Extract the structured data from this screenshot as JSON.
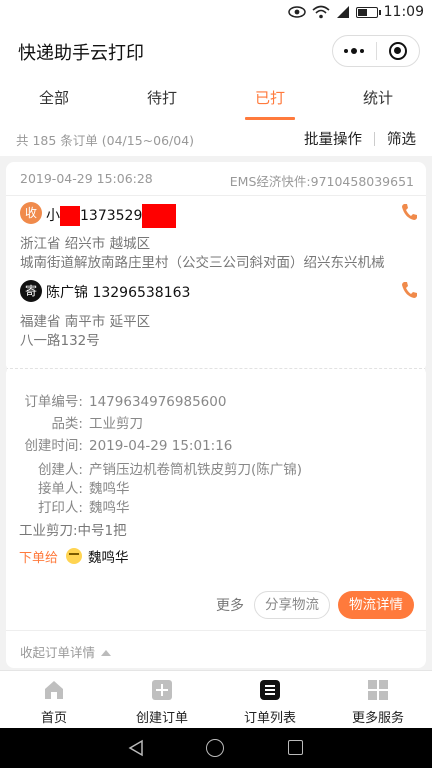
{
  "status_bar": {
    "time": "11:09"
  },
  "app": {
    "title": "快递助手云打印"
  },
  "tabs": [
    {
      "label": "全部"
    },
    {
      "label": "待打"
    },
    {
      "label": "已打",
      "active": true
    },
    {
      "label": "统计"
    }
  ],
  "summary": {
    "count_text": "共 185 条订单 (04/15~06/04)",
    "batch_label": "批量操作",
    "filter_label": "筛选"
  },
  "order": {
    "created_at": "2019-04-29 15:06:28",
    "waybill": "EMS经济快件:9710458039651",
    "receiver": {
      "badge": "收",
      "name_prefix": "小",
      "phone_partial": "1373529",
      "addr_line1": "浙江省 绍兴市 越城区",
      "addr_line2": "城南街道解放南路庄里村（公交三公司斜对面）绍兴东兴机械"
    },
    "sender": {
      "badge": "寄",
      "name": "陈广锦",
      "phone": "13296538163",
      "addr_line1": "福建省 南平市 延平区",
      "addr_line2": "八一路132号"
    },
    "fields": [
      {
        "label": "订单编号:",
        "value": "1479634976985600"
      },
      {
        "label": "品类:",
        "value": "工业剪刀"
      },
      {
        "label": "创建时间:",
        "value": "2019-04-29 15:01:16"
      },
      {
        "label": "创建人:",
        "value": "产销压边机卷筒机铁皮剪刀(陈广锦)"
      },
      {
        "label": "接单人:",
        "value": "魏鸣华"
      },
      {
        "label": "打印人:",
        "value": "魏鸣华"
      }
    ],
    "item_line": "工业剪刀:中号1把",
    "assign_label": "下单给",
    "assignee": "魏鸣华",
    "more_label": "更多",
    "share_label": "分享物流",
    "track_label": "物流详情",
    "collapse_label": "收起订单详情"
  },
  "bottom_nav": [
    {
      "label": "首页",
      "icon": "home-icon"
    },
    {
      "label": "创建订单",
      "icon": "plus-square-icon"
    },
    {
      "label": "订单列表",
      "icon": "list-icon",
      "active": true
    },
    {
      "label": "更多服务",
      "icon": "grid-icon"
    }
  ],
  "colors": {
    "accent": "#ff7a3c",
    "redaction": "#ff0000"
  }
}
